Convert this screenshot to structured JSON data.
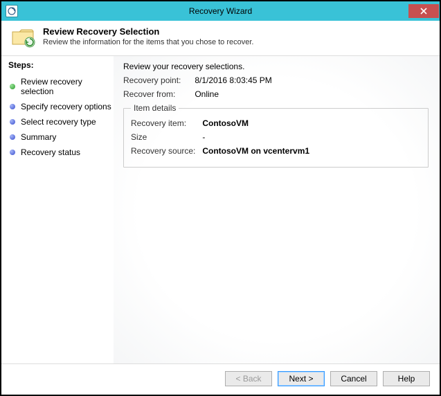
{
  "window": {
    "title": "Recovery Wizard"
  },
  "header": {
    "title": "Review Recovery Selection",
    "subtitle": "Review the information for the items that you chose to recover."
  },
  "sidebar": {
    "title": "Steps:",
    "items": [
      {
        "label": "Review recovery selection",
        "state": "current"
      },
      {
        "label": "Specify recovery options",
        "state": "todo"
      },
      {
        "label": "Select recovery type",
        "state": "todo"
      },
      {
        "label": "Summary",
        "state": "todo"
      },
      {
        "label": "Recovery status",
        "state": "todo"
      }
    ]
  },
  "content": {
    "intro": "Review your recovery selections.",
    "recovery_point_label": "Recovery point:",
    "recovery_point_value": "8/1/2016 8:03:45 PM",
    "recover_from_label": "Recover from:",
    "recover_from_value": "Online",
    "item_details_legend": "Item details",
    "recovery_item_label": "Recovery item:",
    "recovery_item_value": "ContosoVM",
    "size_label": "Size",
    "size_value": "-",
    "recovery_source_label": "Recovery source:",
    "recovery_source_value": "ContosoVM on vcentervm1"
  },
  "footer": {
    "back": "< Back",
    "next": "Next >",
    "cancel": "Cancel",
    "help": "Help"
  }
}
